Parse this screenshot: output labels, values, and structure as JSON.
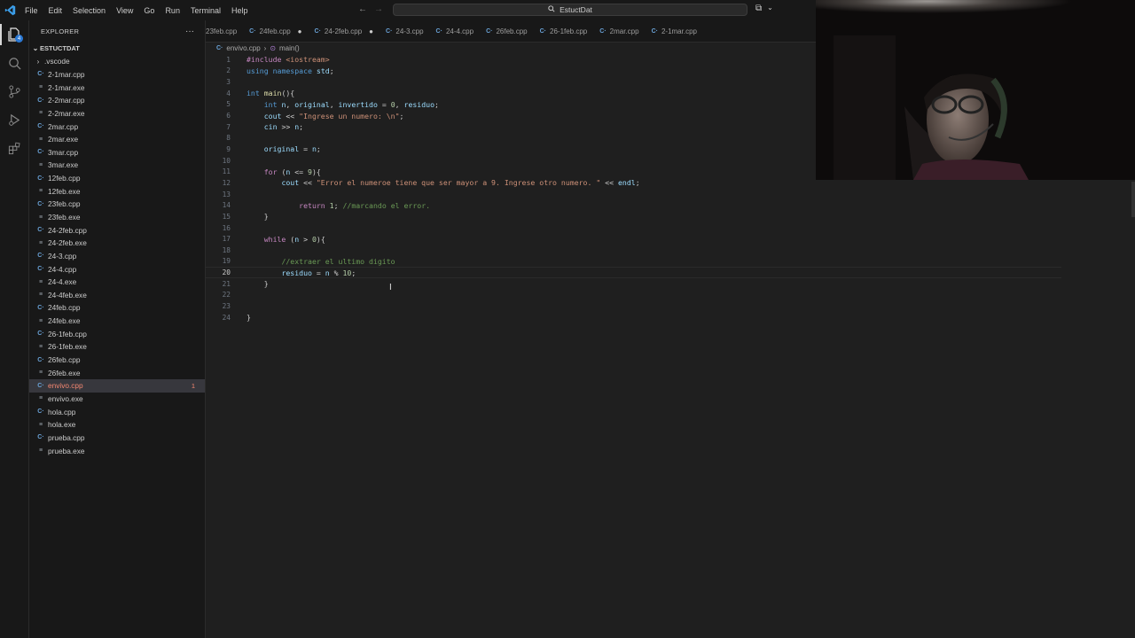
{
  "menu": [
    "File",
    "Edit",
    "Selection",
    "View",
    "Go",
    "Run",
    "Terminal",
    "Help"
  ],
  "search": {
    "title": "EstuctDat"
  },
  "explorer": {
    "title": "EXPLORER",
    "folder": "ESTUCTDAT",
    "items": [
      {
        "name": ".vscode",
        "type": "folder"
      },
      {
        "name": "2-1mar.cpp",
        "type": "cpp"
      },
      {
        "name": "2-1mar.exe",
        "type": "exe"
      },
      {
        "name": "2-2mar.cpp",
        "type": "cpp"
      },
      {
        "name": "2-2mar.exe",
        "type": "exe"
      },
      {
        "name": "2mar.cpp",
        "type": "cpp"
      },
      {
        "name": "2mar.exe",
        "type": "exe"
      },
      {
        "name": "3mar.cpp",
        "type": "cpp"
      },
      {
        "name": "3mar.exe",
        "type": "exe"
      },
      {
        "name": "12feb.cpp",
        "type": "cpp"
      },
      {
        "name": "12feb.exe",
        "type": "exe"
      },
      {
        "name": "23feb.cpp",
        "type": "cpp"
      },
      {
        "name": "23feb.exe",
        "type": "exe"
      },
      {
        "name": "24-2feb.cpp",
        "type": "cpp"
      },
      {
        "name": "24-2feb.exe",
        "type": "exe"
      },
      {
        "name": "24-3.cpp",
        "type": "cpp"
      },
      {
        "name": "24-4.cpp",
        "type": "cpp"
      },
      {
        "name": "24-4.exe",
        "type": "exe"
      },
      {
        "name": "24-4feb.exe",
        "type": "exe"
      },
      {
        "name": "24feb.cpp",
        "type": "cpp"
      },
      {
        "name": "24feb.exe",
        "type": "exe"
      },
      {
        "name": "26-1feb.cpp",
        "type": "cpp"
      },
      {
        "name": "26-1feb.exe",
        "type": "exe"
      },
      {
        "name": "26feb.cpp",
        "type": "cpp"
      },
      {
        "name": "26feb.exe",
        "type": "exe"
      },
      {
        "name": "envivo.cpp",
        "type": "cpp",
        "active": true,
        "problems": "1"
      },
      {
        "name": "envivo.exe",
        "type": "exe"
      },
      {
        "name": "hola.cpp",
        "type": "cpp"
      },
      {
        "name": "hola.exe",
        "type": "exe"
      },
      {
        "name": "prueba.cpp",
        "type": "cpp"
      },
      {
        "name": "prueba.exe",
        "type": "exe"
      }
    ]
  },
  "tabs": [
    {
      "label": "23feb.cpp",
      "dirty": false
    },
    {
      "label": "24feb.cpp",
      "dirty": true
    },
    {
      "label": "24-2feb.cpp",
      "dirty": true
    },
    {
      "label": "24-3.cpp",
      "dirty": false
    },
    {
      "label": "24-4.cpp",
      "dirty": false
    },
    {
      "label": "26feb.cpp",
      "dirty": false
    },
    {
      "label": "26-1feb.cpp",
      "dirty": false
    },
    {
      "label": "2mar.cpp",
      "dirty": false
    },
    {
      "label": "2-1mar.cpp",
      "dirty": false
    }
  ],
  "breadcrumb": {
    "file": "envivo.cpp",
    "symbol": "main()"
  },
  "editor": {
    "current_line": 20,
    "lines": [
      "#include <iostream>",
      "using namespace std;",
      "",
      "int main(){",
      "    int n, original, invertido = 0, residuo;",
      "    cout << \"Ingrese un numero: \\n\";",
      "    cin >> n;",
      "",
      "    original = n;",
      "",
      "    for (n <= 9){",
      "        cout << \"Error el numeroe tiene que ser mayor a 9. Ingrese otro numero. \" << endl;",
      "",
      "            return 1; //marcando el error.",
      "    }",
      "",
      "    while (n > 0){",
      "",
      "        //extraer el ultimo digito",
      "        residuo = n % 10;",
      "    }",
      "",
      "",
      "}"
    ]
  },
  "activity_badge": "4",
  "colors": {
    "accent": "#2b79d5",
    "error": "#f48771",
    "background": "#1f1f1f"
  }
}
